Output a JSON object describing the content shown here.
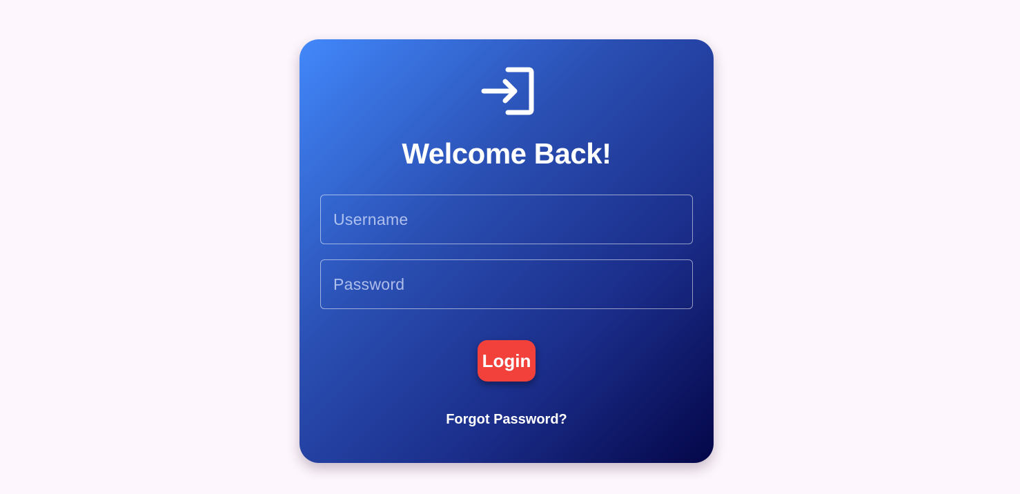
{
  "header": {
    "icon": "login-icon",
    "title": "Welcome Back!"
  },
  "form": {
    "username_placeholder": "Username",
    "username_value": "",
    "password_placeholder": "Password",
    "password_value": "",
    "login_label": "Login",
    "forgot_label": "Forgot Password?"
  },
  "colors": {
    "page_background": "#fdf6fc",
    "card_gradient_start": "#4288fb",
    "card_gradient_end": "#040648",
    "login_button": "#f1413a",
    "text": "#ffffff"
  }
}
